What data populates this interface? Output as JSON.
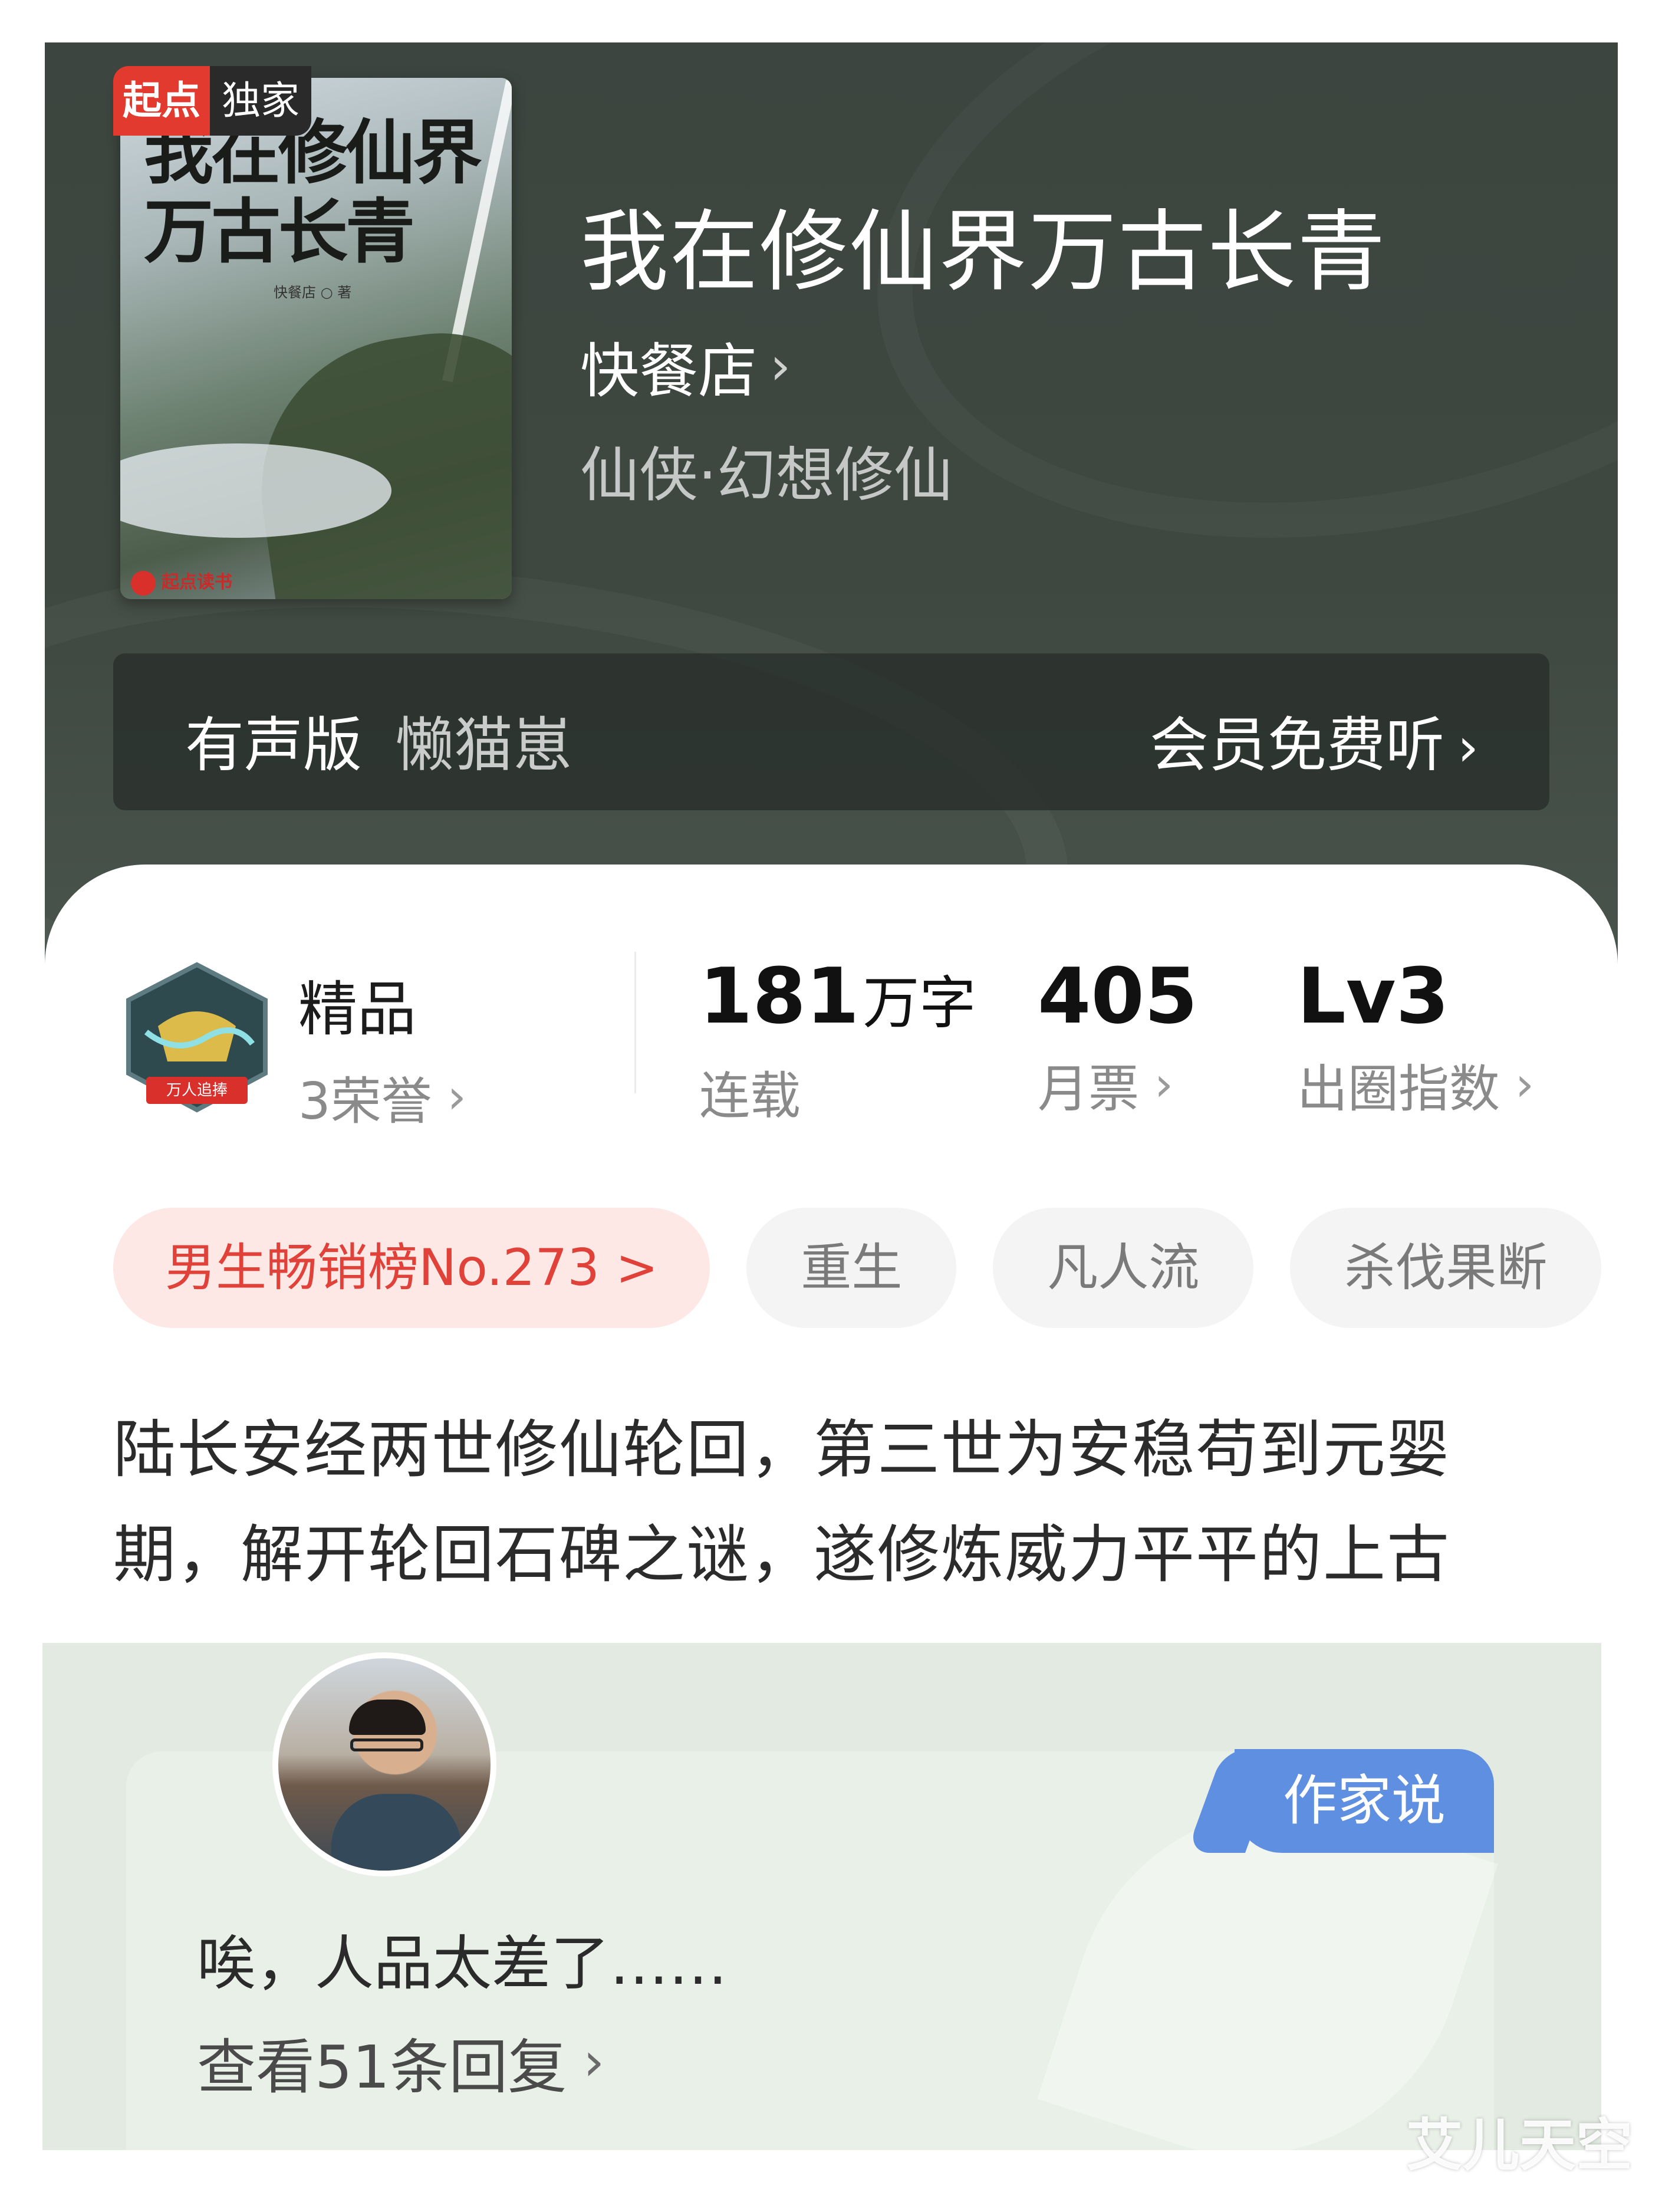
{
  "header": {
    "badge": {
      "brand": "起点",
      "label": "独家"
    },
    "cover": {
      "title_line1": "我在修仙界",
      "title_line2": "万古长青",
      "author": "快餐店 ○ 著",
      "brand": "起点读书"
    },
    "title": "我在修仙界万古长青",
    "author": "快餐店",
    "genre": "仙侠·幻想修仙",
    "audio": {
      "label": "有声版",
      "narrator": "懒猫崽",
      "action": "会员免费听"
    },
    "chevron": "›"
  },
  "stats": {
    "quality": {
      "label": "精品",
      "honors": "3荣誉",
      "medal_text": "万人追捧"
    },
    "words": {
      "value": "181",
      "unit": "万字",
      "status": "连载"
    },
    "monthly_tickets": {
      "value": "405",
      "label": "月票"
    },
    "popularity": {
      "value": "Lv3",
      "label": "出圈指数"
    }
  },
  "tags": {
    "rank": "男生畅销榜No.273 >",
    "items": [
      "重生",
      "凡人流",
      "杀伐果断"
    ]
  },
  "description": {
    "line1": "陆长安经两世修仙轮回，第三世为安稳苟到元婴",
    "line2": "期，解开轮回石碑之谜，遂修炼威力平平的上古"
  },
  "author_says": {
    "tag": "作家说",
    "text": "唉，人品太差了……",
    "replies": "查看51条回复"
  },
  "watermark": "艾儿天空",
  "colors": {
    "header_bg": "#3e4840",
    "accent_red": "#e0423a",
    "writer_tag": "#5f8fe0",
    "panel_bg": "#e2eae1"
  }
}
